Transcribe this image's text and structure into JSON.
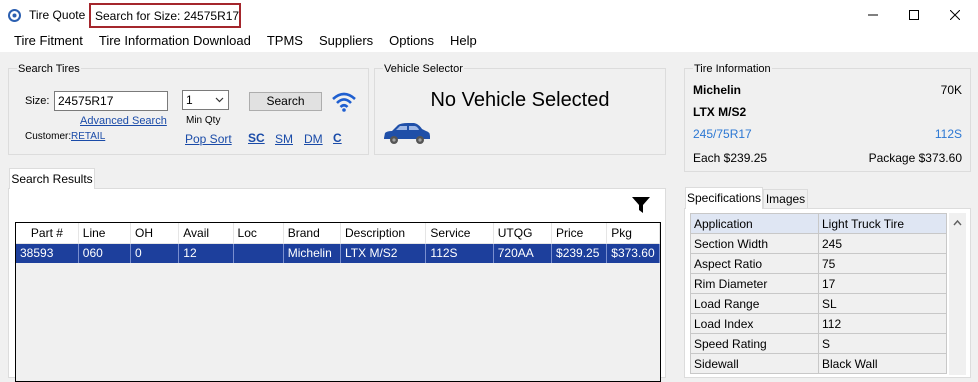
{
  "window": {
    "app_title": "Tire Quote",
    "document_title": "Search for Size: 24575R17",
    "icons": {
      "app": "tire-app-icon",
      "minimize": "minimize-icon",
      "maximize": "maximize-icon",
      "close": "close-icon"
    }
  },
  "menu": [
    "Tire Fitment",
    "Tire Information Download",
    "TPMS",
    "Suppliers",
    "Options",
    "Help"
  ],
  "search_tires": {
    "group_label": "Search Tires",
    "size_label": "Size:",
    "size_value": "24575R17",
    "qty_value": "1",
    "min_qty_label": "Min Qty",
    "search_button": "Search",
    "advanced_search": "Advanced Search",
    "customer_label": "Customer:",
    "customer_value": "RETAIL",
    "pop_sort": "Pop Sort",
    "sc": "SC",
    "sm": "SM",
    "dm": "DM",
    "c": "C",
    "wifi_icon": "wifi-icon"
  },
  "vehicle_selector": {
    "group_label": "Vehicle Selector",
    "status": "No Vehicle Selected",
    "car_icon": "car-icon",
    "car_color": "#1f4fa8"
  },
  "tire_information": {
    "group_label": "Tire Information",
    "brand": "Michelin",
    "load_range": "70K",
    "model": "LTX M/S2",
    "size": "245/75R17",
    "service": "112S",
    "each_price": "Each $239.25",
    "package_price": "Package $373.60",
    "link_color": "#2b77d3"
  },
  "search_results": {
    "tab_label": "Search Results",
    "filter_icon": "filter-icon",
    "columns": [
      "Part #",
      "Line",
      "OH",
      "Avail",
      "Loc",
      "Brand",
      "Description",
      "Service",
      "UTQG",
      "Price",
      "Pkg"
    ],
    "rows": [
      [
        "38593",
        "060",
        "0",
        "12",
        "",
        "Michelin",
        "LTX M/S2",
        "112S",
        "720AA",
        "$239.25",
        "$373.60"
      ]
    ],
    "selected_color": "#1d3f9c"
  },
  "specs_panel": {
    "tabs": [
      "Specifications",
      "Images"
    ],
    "header": [
      "Application",
      "Light Truck Tire"
    ],
    "rows": [
      [
        "Section Width",
        "245"
      ],
      [
        "Aspect Ratio",
        "75"
      ],
      [
        "Rim Diameter",
        "17"
      ],
      [
        "Load Range",
        "SL"
      ],
      [
        "Load Index",
        "112"
      ],
      [
        "Speed Rating",
        "S"
      ],
      [
        "Sidewall",
        "Black Wall"
      ]
    ],
    "scroll_up_icon": "chevron-up-icon"
  }
}
